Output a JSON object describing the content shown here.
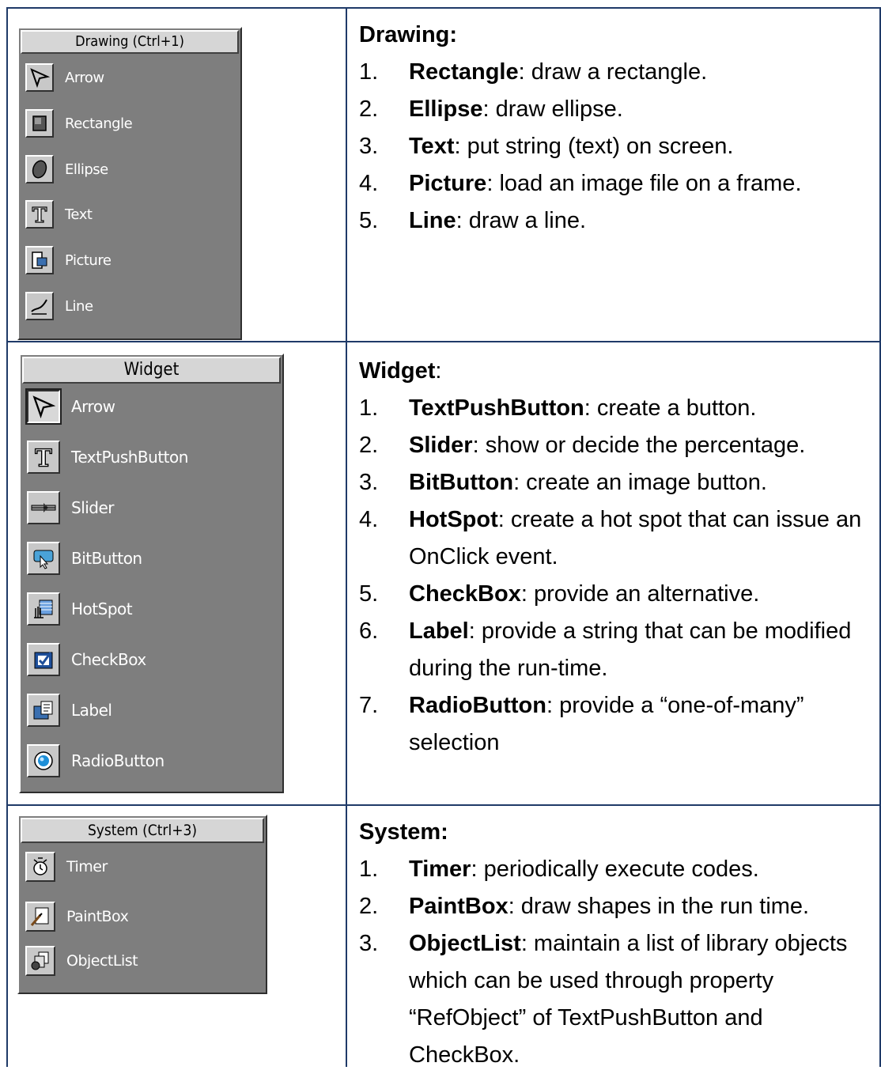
{
  "rows": [
    {
      "palette": {
        "title": "Drawing (Ctrl+1)",
        "tools": [
          {
            "label": "Arrow",
            "icon": "arrow-icon"
          },
          {
            "label": "Rectangle",
            "icon": "rectangle-icon"
          },
          {
            "label": "Ellipse",
            "icon": "ellipse-icon"
          },
          {
            "label": "Text",
            "icon": "text-icon"
          },
          {
            "label": "Picture",
            "icon": "picture-icon"
          },
          {
            "label": "Line",
            "icon": "line-icon"
          }
        ]
      },
      "heading_bold": "Drawing:",
      "heading_rest": "",
      "items": [
        {
          "num": "1.",
          "term": "Rectangle",
          "text": ": draw a rectangle."
        },
        {
          "num": "2.",
          "term": "Ellipse",
          "text": ": draw ellipse."
        },
        {
          "num": "3.",
          "term": "Text",
          "text": ": put string (text) on screen."
        },
        {
          "num": "4.",
          "term": "Picture",
          "text": ": load an image file on a frame."
        },
        {
          "num": "5.",
          "term": "Line",
          "text": ": draw a line."
        }
      ]
    },
    {
      "palette": {
        "title": "Widget",
        "tools": [
          {
            "label": "Arrow",
            "icon": "arrow-icon"
          },
          {
            "label": "TextPushButton",
            "icon": "text-icon"
          },
          {
            "label": "Slider",
            "icon": "slider-icon"
          },
          {
            "label": "BitButton",
            "icon": "bitbutton-icon"
          },
          {
            "label": "HotSpot",
            "icon": "hotspot-icon"
          },
          {
            "label": "CheckBox",
            "icon": "checkbox-icon"
          },
          {
            "label": "Label",
            "icon": "label-icon"
          },
          {
            "label": "RadioButton",
            "icon": "radiobutton-icon"
          }
        ]
      },
      "heading_bold": "Widget",
      "heading_rest": ":",
      "items": [
        {
          "num": "1.",
          "term": "TextPushButton",
          "text": ": create a button."
        },
        {
          "num": "2.",
          "term": "Slider",
          "text": ": show or decide the percentage."
        },
        {
          "num": "3.",
          "term": "BitButton",
          "text": ": create an image button."
        },
        {
          "num": "4.",
          "term": "HotSpot",
          "text": ": create a hot spot that can issue an OnClick event."
        },
        {
          "num": "5.",
          "term": "CheckBox",
          "text": ": provide an alternative."
        },
        {
          "num": "6.",
          "term": "Label",
          "text": ": provide a string that can be modified during the run-time."
        },
        {
          "num": "7.",
          "term": "RadioButton",
          "text": ": provide a “one-of-many” selection"
        }
      ]
    },
    {
      "palette": {
        "title": "System (Ctrl+3)",
        "tools": [
          {
            "label": "Timer",
            "icon": "timer-icon"
          },
          {
            "label": "PaintBox",
            "icon": "paintbox-icon"
          },
          {
            "label": "ObjectList",
            "icon": "objectlist-icon"
          }
        ]
      },
      "heading_bold": "System:",
      "heading_rest": "",
      "items": [
        {
          "num": "1.",
          "term": "Timer",
          "text": ": periodically execute codes."
        },
        {
          "num": "2.",
          "term": "PaintBox",
          "text": ": draw shapes in the run time."
        },
        {
          "num": "3.",
          "term": "ObjectList",
          "text": ": maintain a list of library objects which can be used through property “RefObject” of TextPushButton and CheckBox."
        }
      ]
    }
  ]
}
